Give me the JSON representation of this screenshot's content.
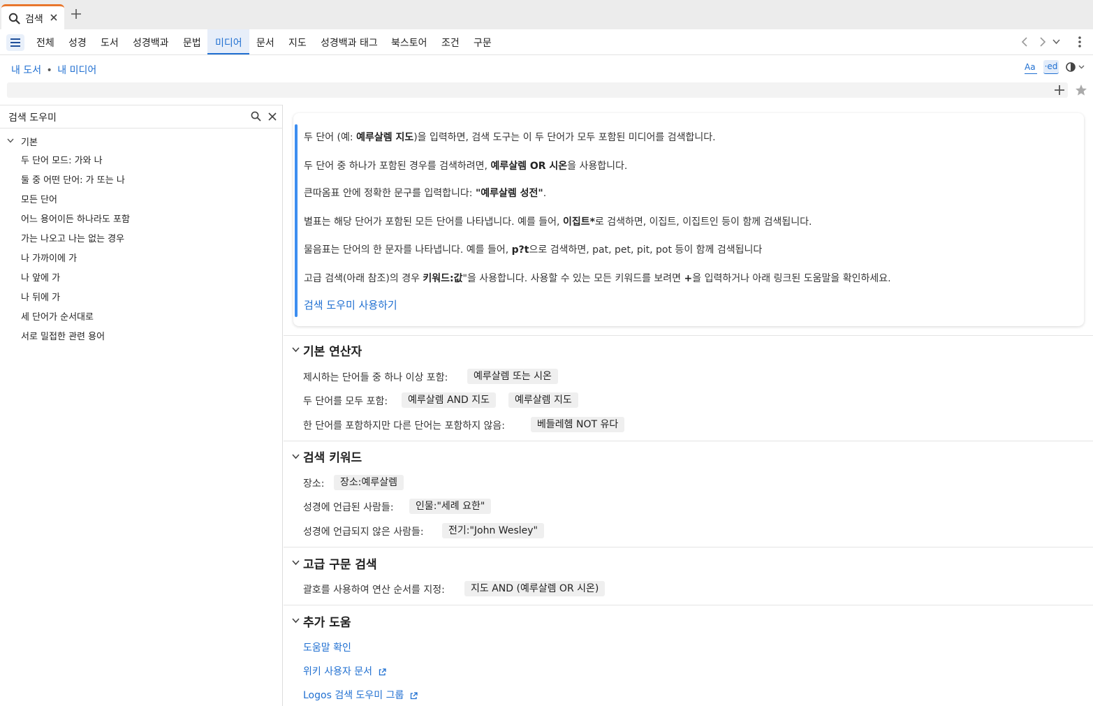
{
  "tab": {
    "label": "검색"
  },
  "nav": {
    "categories": [
      "전체",
      "성경",
      "도서",
      "성경백과",
      "문법",
      "미디어",
      "문서",
      "지도",
      "성경백과 태그",
      "북스토어",
      "조건",
      "구문"
    ],
    "active": "미디어"
  },
  "breadcrumb": {
    "library": "내 도서",
    "separator": "•",
    "media": "내 미디어"
  },
  "toolbar": {
    "font_label": "Aa",
    "ed_label": "·ed"
  },
  "sidebar": {
    "title": "검색 도우미",
    "group": "기본",
    "items": [
      "두 단어 모드: 가와 나",
      "둘 중 어떤 단어: 가 또는 나",
      "모든 단어",
      "어느 용어이든 하나라도 포함",
      "가는 나오고 나는 없는 경우",
      "나 가까이에 가",
      "나 앞에 가",
      "나 뒤에 가",
      "세 단어가 순서대로",
      "서로 밀접한 관련 용어"
    ]
  },
  "info": {
    "line1_a": "두 단어 (예: ",
    "line1_b": "예루살렘 지도",
    "line1_c": ")을 입력하면, 검색 도구는 이 두 단어가 모두 포함된 미디어를 검색합니다.",
    "line2_a": "두 단어 중 하나가 포함된 경우를 검색하려면, ",
    "line2_b": "예루살렘 OR 시온",
    "line2_c": "을 사용합니다.",
    "line3_a": "큰따옴표 안에 정확한 문구를 입력합니다: ",
    "line3_b": "\"예루살렘 성전\"",
    "line3_c": ".",
    "line4_a": "별표는 해당 단어가 포함된 모든 단어를 나타냅니다. 예를 들어, ",
    "line4_b": "이집트*",
    "line4_c": "로 검색하면, 이집트, 이집트인 등이 함께 검색됩니다.",
    "line5_a": "물음표는 단어의 한 문자를 나타냅니다. 예를 들어,  ",
    "line5_b": "p?t",
    "line5_c": "으로 검색하면, pat, pet, pit, pot 등이 함께 검색됩니다",
    "line6_a": "고급 검색(아래 참조)의 경우 ",
    "line6_b": "키워드:값",
    "line6_c": "\"을 사용합니다. 사용할 수 있는 모든 키워드를 보려면 ",
    "line6_d": "+",
    "line6_e": "을 입력하거나 아래 링크된 도움말을 확인하세요.",
    "link": "검색 도우미 사용하기"
  },
  "sections": {
    "basic": {
      "title": "기본 연산자",
      "row1_label": "제시하는 단어들 중 하나 이상 포함:",
      "row1_chip": "예루살렘 또는 시온",
      "row2_label": "두 단어를 모두 포함:",
      "row2_chip1": "예루살렘 AND 지도",
      "row2_chip2": "예루살렘 지도",
      "row3_label": "한 단어를 포함하지만 다른 단어는 포함하지 않음:",
      "row3_chip": "베들레헴 NOT 유다"
    },
    "keywords": {
      "title": "검색 키워드",
      "row1_label": "장소:",
      "row1_chip": "장소:예루살렘",
      "row2_label": "성경에 언급된 사람들:",
      "row2_chip": "인물:\"세례 요한\"",
      "row3_label": "성경에 언급되지 않은 사람들:",
      "row3_chip": "전기:\"John Wesley\""
    },
    "advanced": {
      "title": "고급 구문 검색",
      "row1_label": "괄호를 사용하여 연산 순서를 지정:",
      "row1_chip": "지도 AND (예루살렘 OR 시온)"
    },
    "more": {
      "title": "추가 도움",
      "link1": "도움말 확인",
      "link2": "위키 사용자 문서",
      "link3": "Logos 검색 도우미 그룹"
    }
  },
  "colors": {
    "accent": "#1f6fd1",
    "tab_accent": "#e8762c",
    "info_bar": "#3d8ef0"
  }
}
